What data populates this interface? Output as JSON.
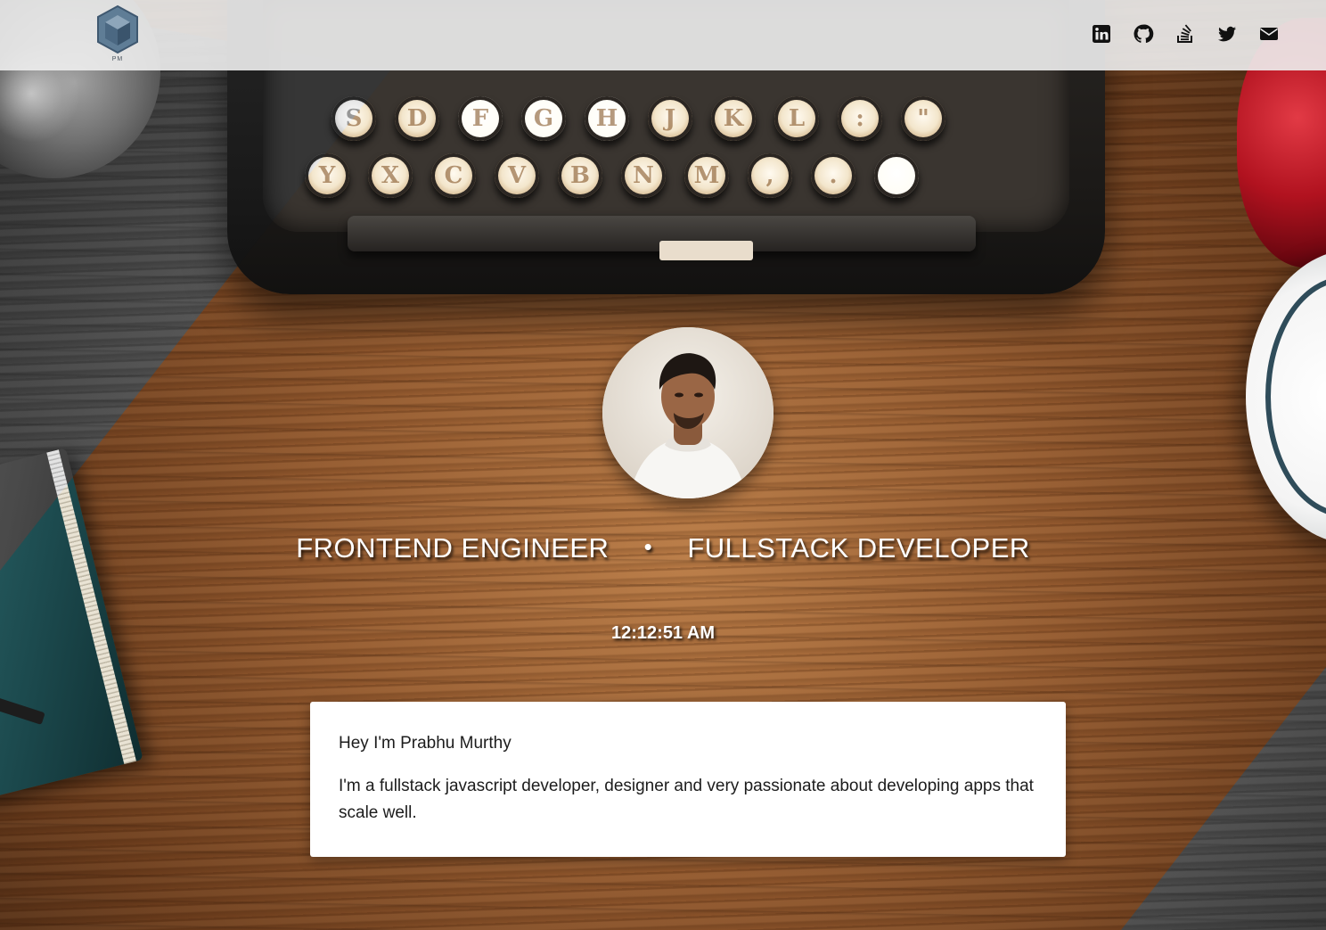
{
  "header": {
    "logo_text": "PM",
    "social_links": [
      {
        "icon": "linkedin-icon",
        "name": "linkedin"
      },
      {
        "icon": "github-icon",
        "name": "github"
      },
      {
        "icon": "stackoverflow-icon",
        "name": "stackoverflow"
      },
      {
        "icon": "twitter-icon",
        "name": "twitter"
      },
      {
        "icon": "email-icon",
        "name": "email"
      }
    ]
  },
  "hero": {
    "role_primary": "FRONTEND ENGINEER",
    "separator": "•",
    "role_secondary": "FULLSTACK DEVELOPER",
    "clock": "12:12:51 AM"
  },
  "intro_card": {
    "greeting": "Hey I'm Prabhu Murthy",
    "bio": "I'm a fullstack javascript developer, designer and very passionate about developing apps that scale well."
  },
  "background": {
    "typewriter_keys_row1": [
      "S",
      "D",
      "F",
      "G",
      "H",
      "J",
      "K",
      "L",
      ":",
      "\""
    ],
    "typewriter_keys_row2": [
      "Y",
      "X",
      "C",
      "V",
      "B",
      "N",
      "M",
      ",",
      ".",
      ""
    ]
  },
  "colors": {
    "header_bg": "#eeeeee",
    "icon_color": "#111111",
    "logo_blue": "#4a6a85",
    "card_bg": "#ffffff",
    "text_light": "#ffffff"
  }
}
